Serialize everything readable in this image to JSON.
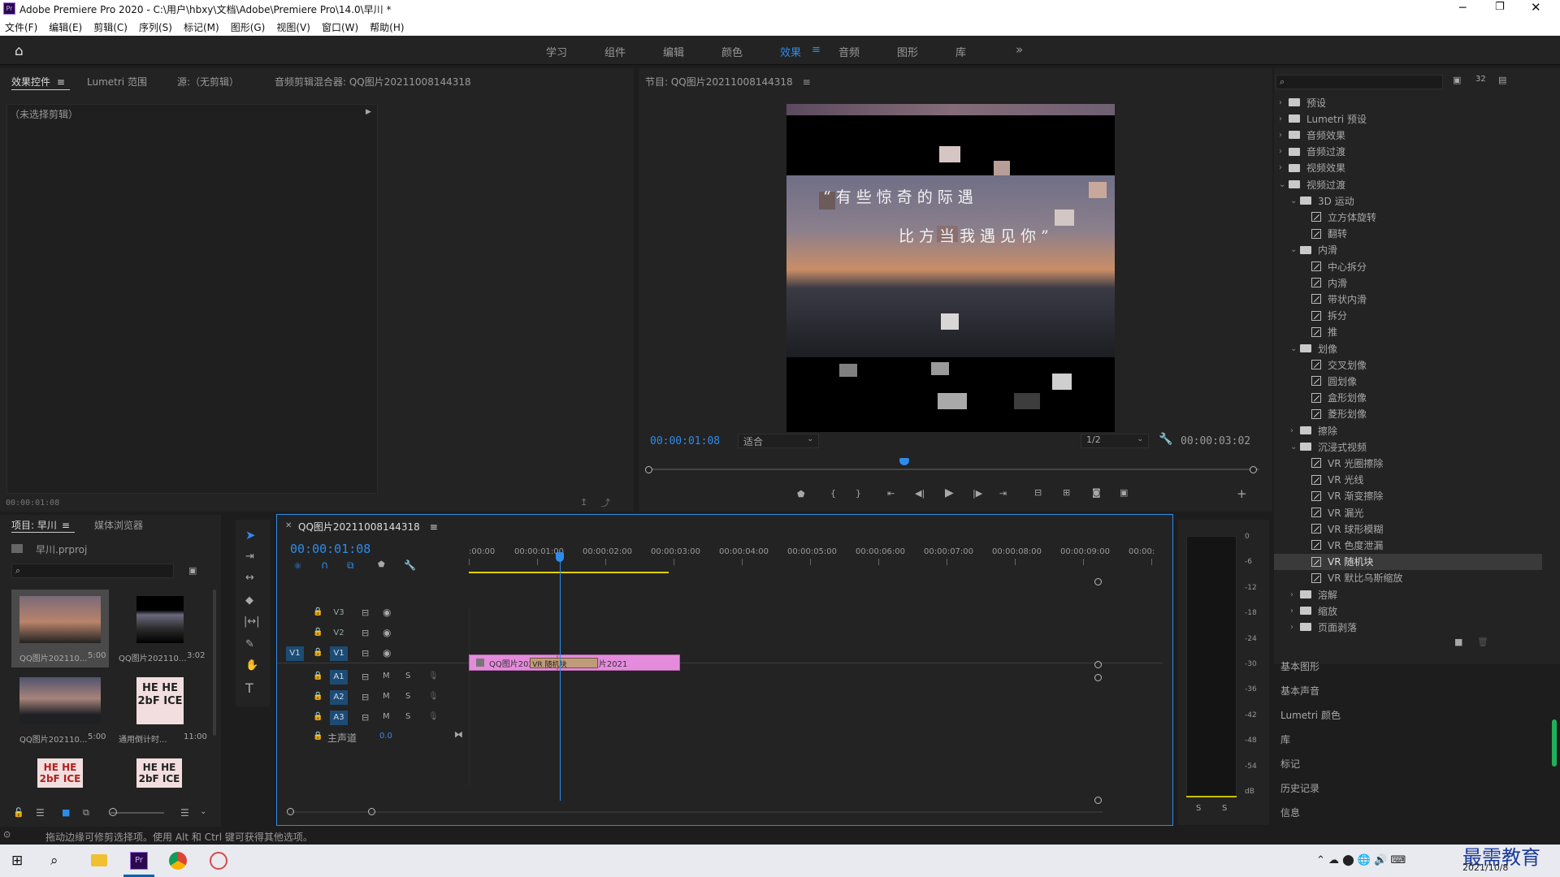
{
  "app": {
    "title": "Adobe Premiere Pro 2020 - C:\\用户\\hbxy\\文档\\Adobe\\Premiere Pro\\14.0\\早川 *",
    "menu": [
      "文件(F)",
      "编辑(E)",
      "剪辑(C)",
      "序列(S)",
      "标记(M)",
      "图形(G)",
      "视图(V)",
      "窗口(W)",
      "帮助(H)"
    ]
  },
  "workspaces": {
    "tabs": [
      "学习",
      "组件",
      "编辑",
      "颜色",
      "效果",
      "音频",
      "图形",
      "库"
    ],
    "active": "效果",
    "more": "»"
  },
  "source_panel": {
    "tabs": [
      "效果控件",
      "Lumetri 范围",
      "源:（无剪辑）",
      "音频剪辑混合器: QQ图片20211008144318"
    ],
    "no_clip": "（未选择剪辑）",
    "timecode": "00:00:01:08"
  },
  "program_panel": {
    "title": "节目: QQ图片20211008144318",
    "timecode": "00:00:01:08",
    "fit": "适合",
    "resolution": "1/2",
    "duration": "00:00:03:02",
    "playhead_fraction": 0.42,
    "overlay_line1": "“有些惊奇的际遇",
    "overlay_line2": "比方当我遇见你”"
  },
  "effects_panel": {
    "search_placeholder": "",
    "tree": [
      {
        "level": 0,
        "type": "folder",
        "label": "预设",
        "open": false
      },
      {
        "level": 0,
        "type": "folder",
        "label": "Lumetri 预设",
        "open": false
      },
      {
        "level": 0,
        "type": "folder",
        "label": "音频效果",
        "open": false
      },
      {
        "level": 0,
        "type": "folder",
        "label": "音频过渡",
        "open": false
      },
      {
        "level": 0,
        "type": "folder",
        "label": "视频效果",
        "open": false
      },
      {
        "level": 0,
        "type": "folder",
        "label": "视频过渡",
        "open": true
      },
      {
        "level": 1,
        "type": "folder",
        "label": "3D 运动",
        "open": true
      },
      {
        "level": 2,
        "type": "fx",
        "label": "立方体旋转"
      },
      {
        "level": 2,
        "type": "fx",
        "label": "翻转"
      },
      {
        "level": 1,
        "type": "folder",
        "label": "内滑",
        "open": true
      },
      {
        "level": 2,
        "type": "fx",
        "label": "中心拆分"
      },
      {
        "level": 2,
        "type": "fx",
        "label": "内滑"
      },
      {
        "level": 2,
        "type": "fx",
        "label": "带状内滑"
      },
      {
        "level": 2,
        "type": "fx",
        "label": "拆分"
      },
      {
        "level": 2,
        "type": "fx",
        "label": "推"
      },
      {
        "level": 1,
        "type": "folder",
        "label": "划像",
        "open": true
      },
      {
        "level": 2,
        "type": "fx",
        "label": "交叉划像"
      },
      {
        "level": 2,
        "type": "fx",
        "label": "圆划像"
      },
      {
        "level": 2,
        "type": "fx",
        "label": "盒形划像"
      },
      {
        "level": 2,
        "type": "fx",
        "label": "菱形划像"
      },
      {
        "level": 1,
        "type": "folder",
        "label": "擦除",
        "open": false
      },
      {
        "level": 1,
        "type": "folder",
        "label": "沉浸式视频",
        "open": true
      },
      {
        "level": 2,
        "type": "fx",
        "label": "VR 光圈擦除"
      },
      {
        "level": 2,
        "type": "fx",
        "label": "VR 光线"
      },
      {
        "level": 2,
        "type": "fx",
        "label": "VR 渐变擦除"
      },
      {
        "level": 2,
        "type": "fx",
        "label": "VR 漏光"
      },
      {
        "level": 2,
        "type": "fx",
        "label": "VR 球形模糊"
      },
      {
        "level": 2,
        "type": "fx",
        "label": "VR 色度泄漏"
      },
      {
        "level": 2,
        "type": "fx",
        "label": "VR 随机块",
        "selected": true
      },
      {
        "level": 2,
        "type": "fx",
        "label": "VR 默比乌斯缩放"
      },
      {
        "level": 1,
        "type": "folder",
        "label": "溶解",
        "open": false
      },
      {
        "level": 1,
        "type": "folder",
        "label": "缩放",
        "open": false
      },
      {
        "level": 1,
        "type": "folder",
        "label": "页面剥落",
        "open": false
      }
    ],
    "bottom_panels": [
      "基本图形",
      "基本声音",
      "Lumetri 颜色",
      "库",
      "标记",
      "历史记录",
      "信息"
    ]
  },
  "project_panel": {
    "tabs": [
      "项目: 早川",
      "媒体浏览器"
    ],
    "file": "早川.prproj",
    "items": [
      {
        "label": "QQ图片2021​10...",
        "duration": "5:00"
      },
      {
        "label": "QQ图片202110...",
        "duration": "3:02"
      },
      {
        "label": "QQ图片202110...",
        "duration": "5:00"
      },
      {
        "label": "通用倒计时...",
        "duration": "11:00"
      },
      {
        "label": "",
        "duration": ""
      },
      {
        "label": "",
        "duration": ""
      }
    ],
    "countdown_text": "HE HE\n2bF ICE"
  },
  "timeline": {
    "title": "QQ图片20211008144318",
    "timecode": "00:00:01:08",
    "ruler": [
      ":00:00",
      "00:00:01:00",
      "00:00:02:00",
      "00:00:03:00",
      "00:00:04:00",
      "00:00:05:00",
      "00:00:06:00",
      "00:00:07:00",
      "00:00:08:00",
      "00:00:09:00",
      "00:00:"
    ],
    "video_tracks": [
      "V3",
      "V2",
      "V1"
    ],
    "audio_tracks": [
      "A1",
      "A2",
      "A3"
    ],
    "source_v1": "V1",
    "master": "主声道",
    "master_value": "0.0",
    "clips": [
      {
        "label": "QQ图片2021",
        "start": 0.0,
        "end": 1.3
      },
      {
        "label": "QQ图片2021",
        "start": 1.3,
        "end": 3.1
      }
    ],
    "transition": "VR 随机块",
    "playhead_seconds": 1.33,
    "track_letters": [
      "M",
      "S"
    ]
  },
  "audio_meter": {
    "scale": [
      "0",
      "-6",
      "-12",
      "-18",
      "-24",
      "-30",
      "-36",
      "-42",
      "-48",
      "-54",
      "dB"
    ],
    "solo": [
      "S",
      "S"
    ]
  },
  "status_bar": {
    "hint": "拖动边缘可修剪选择项。使用 Alt 和 Ctrl 键可获得其他选项。"
  },
  "taskbar": {
    "date": "2021/10/8",
    "watermark": "最需教育"
  },
  "colors": {
    "accent": "#2d8ceb",
    "clip": "#e58bdc",
    "panel": "#232323",
    "bg": "#1d1d1d"
  }
}
